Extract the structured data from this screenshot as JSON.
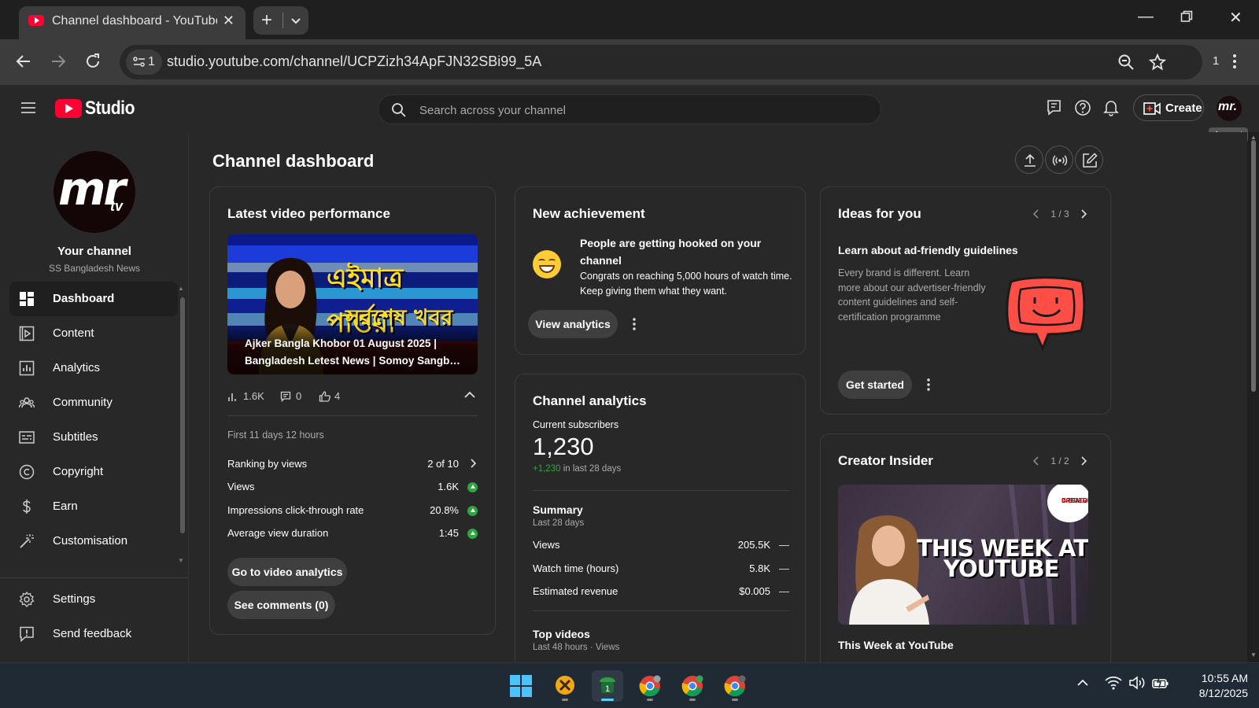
{
  "browser": {
    "tab_title": "Channel dashboard - YouTube Studio",
    "url": "studio.youtube.com/channel/UCPZizh34ApFJN32SBi99_5A",
    "site_badge": "1",
    "extension_count": "1"
  },
  "header": {
    "logo_text": "Studio",
    "search_placeholder": "Search across your channel",
    "create_label": "Create",
    "avatar_text": "mr.",
    "account_tooltip": "Account"
  },
  "sidebar": {
    "channel_avatar_main": "mr",
    "channel_avatar_sub": "tv",
    "channel_label": "Your channel",
    "channel_name": "SS Bangladesh News",
    "items": [
      {
        "label": "Dashboard",
        "icon": "dashboard-icon"
      },
      {
        "label": "Content",
        "icon": "content-icon"
      },
      {
        "label": "Analytics",
        "icon": "analytics-icon"
      },
      {
        "label": "Community",
        "icon": "community-icon"
      },
      {
        "label": "Subtitles",
        "icon": "subtitles-icon"
      },
      {
        "label": "Copyright",
        "icon": "copyright-icon"
      },
      {
        "label": "Earn",
        "icon": "earn-icon"
      },
      {
        "label": "Customisation",
        "icon": "customisation-icon"
      }
    ],
    "bottom_items": [
      {
        "label": "Settings",
        "icon": "gear-icon"
      },
      {
        "label": "Send feedback",
        "icon": "feedback-icon"
      }
    ]
  },
  "main": {
    "title": "Channel dashboard",
    "latest_video": {
      "title": "Latest video performance",
      "thumb_text_1": "এইমাত্র পাওয়া",
      "thumb_text_2": "সর্বশেষ খবর",
      "video_title_line1": "Ajker Bangla Khobor 01 August 2025 |",
      "video_title_line2": "Bangladesh Letest News | Somoy Sangbad News",
      "views_stat": "1.6K",
      "comments_stat": "0",
      "likes_stat": "4",
      "period": "First 11 days 12 hours",
      "rows": [
        {
          "label": "Ranking by views",
          "value": "2 of 10"
        },
        {
          "label": "Views",
          "value": "1.6K"
        },
        {
          "label": "Impressions click-through rate",
          "value": "20.8%"
        },
        {
          "label": "Average view duration",
          "value": "1:45"
        }
      ],
      "analytics_btn": "Go to video analytics",
      "comments_btn": "See comments (0)"
    },
    "achievement": {
      "title": "New achievement",
      "headline": "People are getting hooked on your channel",
      "body": "Congrats on reaching 5,000 hours of watch time. Keep giving them what they want.",
      "button": "View analytics"
    },
    "channel_analytics": {
      "title": "Channel analytics",
      "subs_label": "Current subscribers",
      "subs_value": "1,230",
      "subs_delta": "+1,230",
      "subs_delta_suffix": " in last 28 days",
      "summary_title": "Summary",
      "summary_period": "Last 28 days",
      "rows": [
        {
          "label": "Views",
          "value": "205.5K",
          "trend": "—"
        },
        {
          "label": "Watch time (hours)",
          "value": "5.8K",
          "trend": "—"
        },
        {
          "label": "Estimated revenue",
          "value": "$0.005",
          "trend": "—"
        }
      ],
      "top_videos_title": "Top videos",
      "top_videos_period": "Last 48 hours · Views"
    },
    "ideas": {
      "title": "Ideas for you",
      "pager": "1 / 3",
      "headline": "Learn about ad-friendly guidelines",
      "body": "Every brand is different. Learn more about our advertiser-friendly content guidelines and self-certification programme",
      "button": "Get started"
    },
    "creator_insider": {
      "title": "Creator Insider",
      "pager": "1 / 2",
      "thumb_line1": "THIS WEEK AT",
      "thumb_line2": "YOUTUBE",
      "badge_line1": "CREATOR",
      "badge_line2": "INSIDER",
      "video_title": "This Week at YouTube"
    }
  },
  "taskbar": {
    "time": "10:55 AM",
    "date": "8/12/2025"
  },
  "colors": {
    "accent_red": "#ff0033",
    "green": "#2ba640",
    "bg_panel": "#282828"
  }
}
